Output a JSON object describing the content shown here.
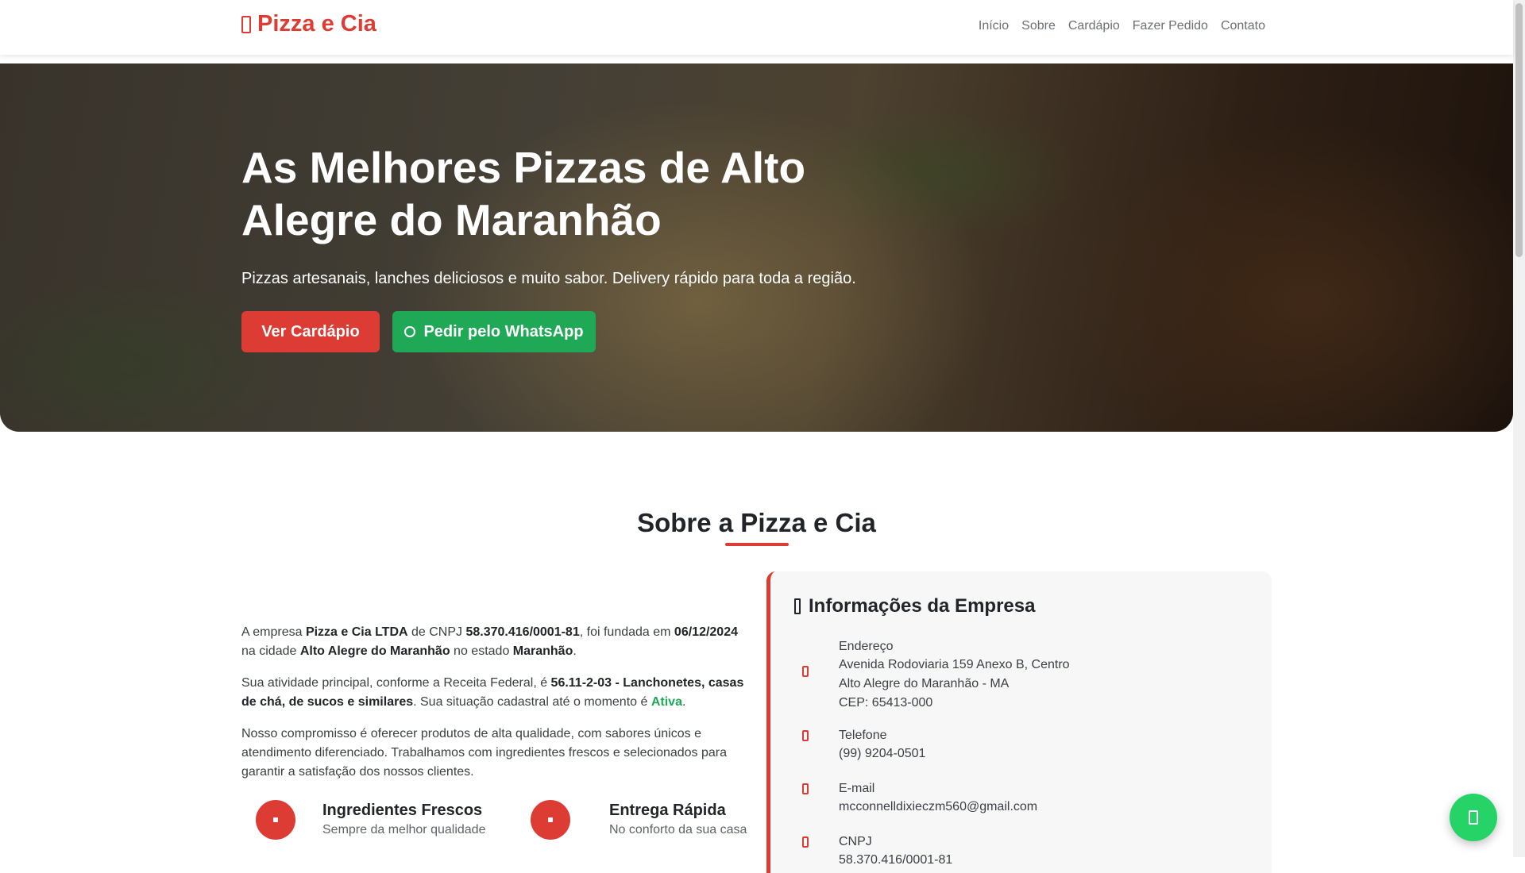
{
  "navbar": {
    "brand": "Pizza e Cia",
    "brand_icon": "pizza-slice-icon",
    "links": [
      "Início",
      "Sobre",
      "Cardápio",
      "Fazer Pedido",
      "Contato"
    ]
  },
  "hero": {
    "title": "As Melhores Pizzas de Alto Alegre do Maranhão",
    "subtitle": "Pizzas artesanais, lanches deliciosos e muito sabor. Delivery rápido para toda a região.",
    "btn_menu": "Ver Cardápio",
    "btn_whatsapp": "Pedir pelo WhatsApp"
  },
  "about": {
    "title": "Sobre a Pizza e Cia",
    "p1": {
      "t1": "A empresa ",
      "company": "Pizza e Cia LTDA",
      "t2": " de CNPJ ",
      "cnpj": "58.370.416/0001-81",
      "t3": ", foi fundada em ",
      "founded": "06/12/2024",
      "t4": " na cidade ",
      "city": "Alto Alegre do Maranhão",
      "t5": " no estado ",
      "state": "Maranhão",
      "t6": "."
    },
    "p2": {
      "t1": "Sua atividade principal, conforme a Receita Federal, é ",
      "activity": "56.11-2-03 - Lanchonetes, casas de chá, de sucos e similares",
      "t2": ". Sua situação cadastral até o momento é ",
      "status": "Ativa",
      "t3": "."
    },
    "p3": "Nosso compromisso é oferecer produtos de alta qualidade, com sabores únicos e atendimento diferenciado. Trabalhamos com ingredientes frescos e selecionados para garantir a satisfação dos nossos clientes.",
    "features": [
      {
        "title": "Ingredientes Frescos",
        "sub": "Sempre da melhor qualidade",
        "icon": "leaf-icon"
      },
      {
        "title": "Entrega Rápida",
        "sub": "No conforto da sua casa",
        "icon": "motorcycle-icon"
      }
    ]
  },
  "info": {
    "title": "Informações da Empresa",
    "address_label": "Endereço",
    "address_line1": "Avenida Rodoviaria 159 Anexo B, Centro",
    "address_line2": "Alto Alegre do Maranhão - MA",
    "address_line3": "CEP: 65413-000",
    "phone_label": "Telefone",
    "phone": "(99) 9204-0501",
    "email_label": "E-mail",
    "email": "mcconnelldixieczm560@gmail.com",
    "cnpj_label": "CNPJ",
    "cnpj": "58.370.416/0001-81"
  },
  "colors": {
    "brand_red": "#dc3c33",
    "whatsapp_green": "#1fa855"
  }
}
